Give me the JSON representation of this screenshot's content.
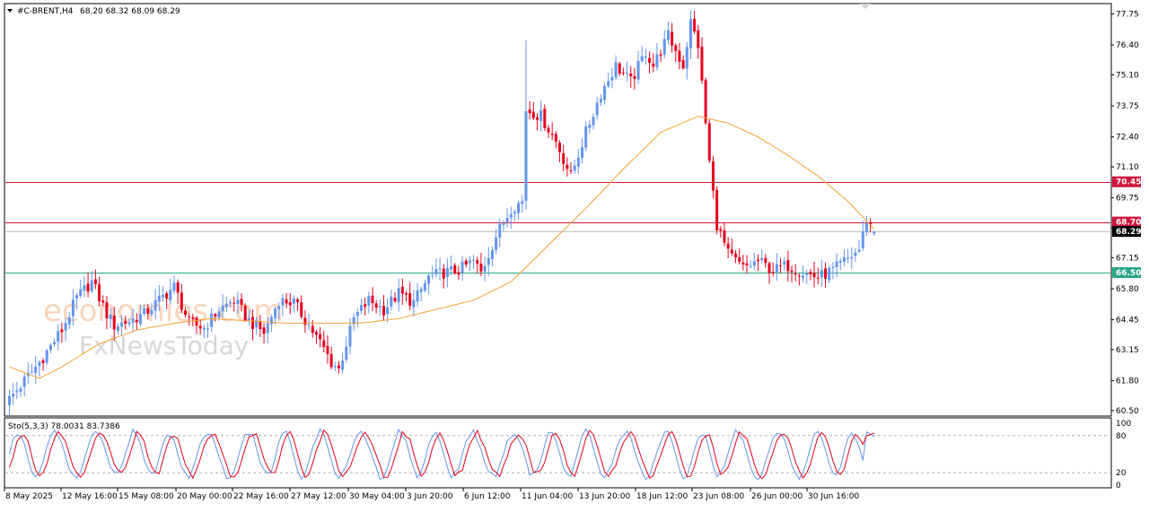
{
  "header": {
    "symbol": "#C-BRENT,H4",
    "ohlc": "68.20 68.32 68.09 68.29"
  },
  "indicator": {
    "label": "Sto(5,3,3) 78.0031 83.7386",
    "levels": [
      "100",
      "80",
      "20",
      "0"
    ]
  },
  "watermark": {
    "brand1": "economies.com",
    "brand2": "FxNewsToday"
  },
  "price_tags": [
    {
      "label": "70.45",
      "value": 70.45,
      "color": "#d0143c",
      "text_color": "#ffffff"
    },
    {
      "label": "68.70",
      "value": 68.7,
      "color": "#d0143c",
      "text_color": "#ffffff"
    },
    {
      "label": "68.29",
      "value": 68.29,
      "color": "#000000",
      "text_color": "#ffffff"
    },
    {
      "label": "66.50",
      "value": 66.5,
      "color": "#2aa889",
      "text_color": "#ffffff"
    }
  ],
  "colors": {
    "bull": "#6495ed",
    "bear": "#e8001c",
    "ma": "#f5a030",
    "resistance": "#d0143c",
    "support": "#2aa889",
    "current": "#bdbdbd",
    "sto_main": "#6495ed",
    "sto_signal": "#e8001c"
  },
  "chart_data": {
    "type": "candlestick",
    "symbol": "#C-BRENT",
    "timeframe": "H4",
    "y_ticks": [
      "77.75",
      "76.40",
      "75.10",
      "73.75",
      "72.40",
      "71.10",
      "69.75",
      "68.45",
      "67.15",
      "65.80",
      "64.45",
      "63.15",
      "61.80",
      "60.50"
    ],
    "y_range": [
      60.3,
      78.2
    ],
    "x_tick_labels": [
      "8 May 2025",
      "12 May 16:00",
      "15 May 08:00",
      "20 May 00:00",
      "22 May 16:00",
      "27 May 12:00",
      "30 May 04:00",
      "3 Jun 20:00",
      "6 Jun 12:00",
      "11 Jun 04:00",
      "13 Jun 20:00",
      "18 Jun 12:00",
      "23 Jun 08:00",
      "26 Jun 00:00",
      "30 Jun 16:00"
    ],
    "horizontal_levels": [
      {
        "value": 70.45,
        "kind": "resistance"
      },
      {
        "value": 68.7,
        "kind": "resistance"
      },
      {
        "value": 68.29,
        "kind": "current price"
      },
      {
        "value": 66.5,
        "kind": "support"
      }
    ],
    "close_path": [
      [
        0,
        61.0
      ],
      [
        8,
        62.6
      ],
      [
        14,
        64.0
      ],
      [
        18,
        65.4
      ],
      [
        22,
        66.1
      ],
      [
        26,
        64.7
      ],
      [
        28,
        64.2
      ],
      [
        32,
        64.4
      ],
      [
        36,
        64.7
      ],
      [
        40,
        65.3
      ],
      [
        44,
        65.9
      ],
      [
        48,
        64.3
      ],
      [
        52,
        64.1
      ],
      [
        56,
        64.9
      ],
      [
        60,
        65.3
      ],
      [
        64,
        64.4
      ],
      [
        68,
        63.9
      ],
      [
        72,
        65.3
      ],
      [
        76,
        65.2
      ],
      [
        80,
        64.2
      ],
      [
        84,
        63.2
      ],
      [
        86,
        62.6
      ],
      [
        88,
        62.3
      ],
      [
        92,
        64.5
      ],
      [
        96,
        65.3
      ],
      [
        100,
        64.9
      ],
      [
        104,
        65.6
      ],
      [
        108,
        65.2
      ],
      [
        112,
        66.3
      ],
      [
        116,
        66.5
      ],
      [
        120,
        66.6
      ],
      [
        124,
        67.0
      ],
      [
        126,
        66.5
      ],
      [
        130,
        68.1
      ],
      [
        134,
        69.3
      ],
      [
        137,
        69.6
      ],
      [
        138,
        73.6
      ],
      [
        142,
        73.3
      ],
      [
        146,
        72.2
      ],
      [
        150,
        70.7
      ],
      [
        154,
        72.6
      ],
      [
        158,
        74.3
      ],
      [
        162,
        75.5
      ],
      [
        166,
        74.8
      ],
      [
        170,
        76.1
      ],
      [
        172,
        75.5
      ],
      [
        176,
        76.8
      ],
      [
        180,
        75.5
      ],
      [
        182,
        77.4
      ],
      [
        184,
        76.4
      ],
      [
        187,
        71.3
      ],
      [
        189,
        68.6
      ],
      [
        192,
        67.3
      ],
      [
        196,
        66.7
      ],
      [
        200,
        67.0
      ],
      [
        204,
        66.6
      ],
      [
        208,
        66.8
      ],
      [
        212,
        66.5
      ],
      [
        216,
        66.3
      ],
      [
        220,
        66.6
      ],
      [
        224,
        67.1
      ],
      [
        227,
        67.5
      ],
      [
        229,
        68.8
      ],
      [
        231,
        68.29
      ]
    ],
    "ma_path": [
      [
        0,
        62.4
      ],
      [
        8,
        61.9
      ],
      [
        14,
        62.4
      ],
      [
        24,
        63.4
      ],
      [
        34,
        64.0
      ],
      [
        44,
        64.3
      ],
      [
        54,
        64.5
      ],
      [
        64,
        64.4
      ],
      [
        74,
        64.3
      ],
      [
        84,
        64.3
      ],
      [
        94,
        64.3
      ],
      [
        104,
        64.5
      ],
      [
        114,
        64.9
      ],
      [
        124,
        65.3
      ],
      [
        134,
        66.1
      ],
      [
        144,
        67.7
      ],
      [
        154,
        69.3
      ],
      [
        164,
        71.0
      ],
      [
        174,
        72.6
      ],
      [
        184,
        73.3
      ],
      [
        192,
        73.0
      ],
      [
        200,
        72.4
      ],
      [
        208,
        71.6
      ],
      [
        216,
        70.7
      ],
      [
        224,
        69.6
      ],
      [
        231,
        68.4
      ]
    ],
    "stochastic": {
      "k_period": 5,
      "d_period": 3,
      "slowing": 3,
      "main": 78.0031,
      "signal": 83.7386,
      "range": [
        0,
        100
      ],
      "levels": [
        20,
        80
      ]
    },
    "candle_count": 232
  }
}
